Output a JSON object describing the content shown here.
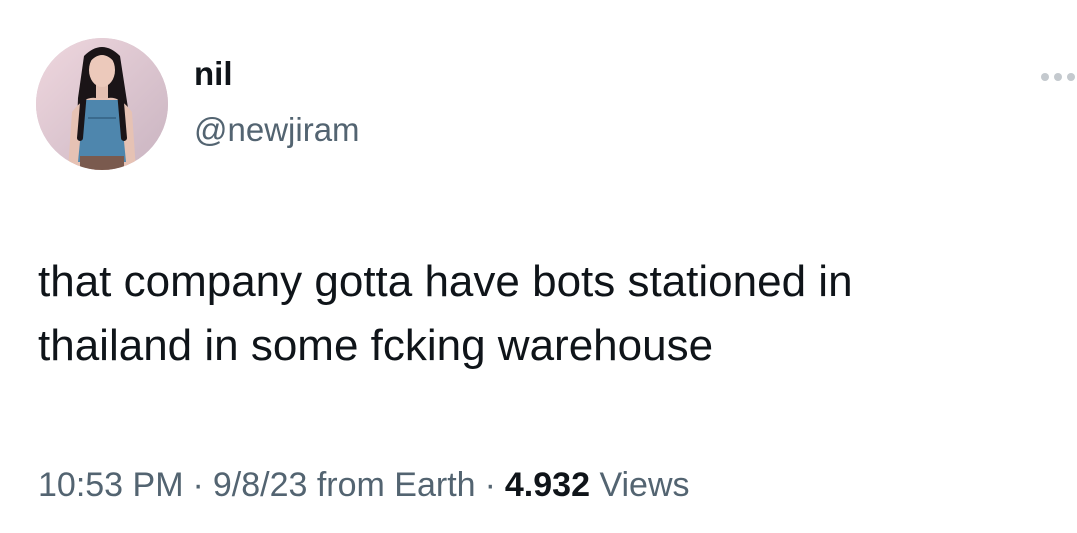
{
  "tweet": {
    "author": {
      "display_name": "nil",
      "handle": "@newjiram",
      "avatar_icon": "profile-photo"
    },
    "more_icon": "more-dots-icon",
    "text": "that company gotta have bots stationed in\nthailand in some fcking warehouse",
    "meta": {
      "time": "10:53 PM",
      "separator": "·",
      "date": "9/8/23",
      "source": "from Earth",
      "views_count": "4.932",
      "views_label": "Views"
    }
  },
  "colors": {
    "text_primary": "#0f1419",
    "text_secondary": "#536471",
    "more_icon": "#c4c9ce",
    "background": "#ffffff"
  }
}
